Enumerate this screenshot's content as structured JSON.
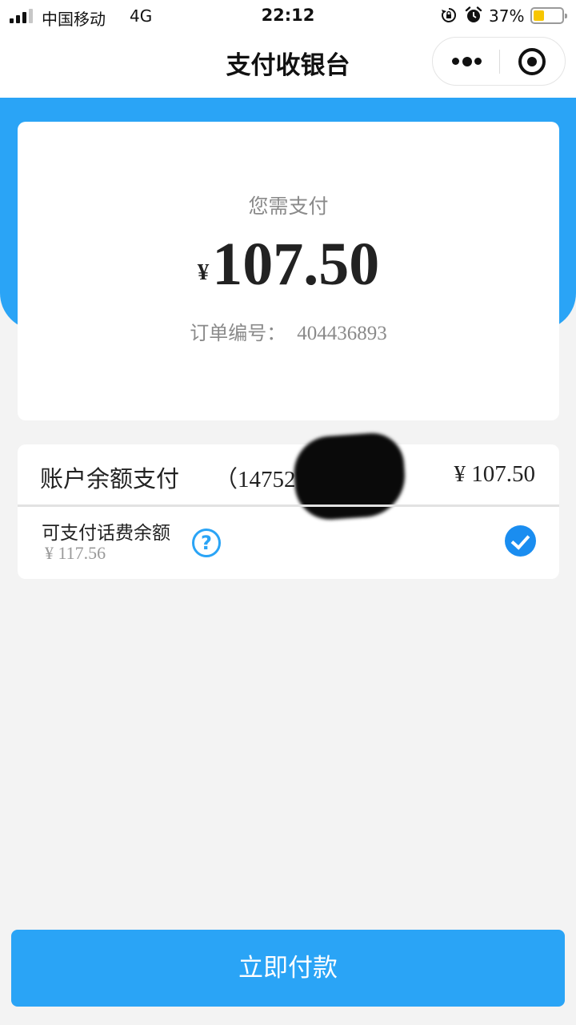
{
  "status_bar": {
    "carrier": "中国移动",
    "network": "4G",
    "time": "22:12",
    "battery_percent": "37%",
    "battery_level": 0.37,
    "icons": [
      "signal-icon",
      "rotation-lock-icon",
      "alarm-icon",
      "battery-icon"
    ]
  },
  "nav": {
    "title": "支付收银台",
    "more_icon": "more-dots-icon",
    "close_icon": "close-target-icon"
  },
  "amount_card": {
    "label": "您需支付",
    "currency": "¥",
    "amount": "107.50",
    "order_label": "订单编号：",
    "order_number": "404436893"
  },
  "payment": {
    "method_label": "账户余额支付",
    "account_text": "（147527",
    "account_close": "）",
    "method_amount": "¥ 107.50",
    "phone_balance_label": "可支付话费余额",
    "phone_balance_amount": "¥ 117.56",
    "help_symbol": "?",
    "selected": true
  },
  "actions": {
    "pay_label": "立即付款"
  },
  "colors": {
    "accent": "#2aa4f6",
    "check": "#1a8df0",
    "background": "#f3f3f3",
    "battery": "#f7c600"
  }
}
